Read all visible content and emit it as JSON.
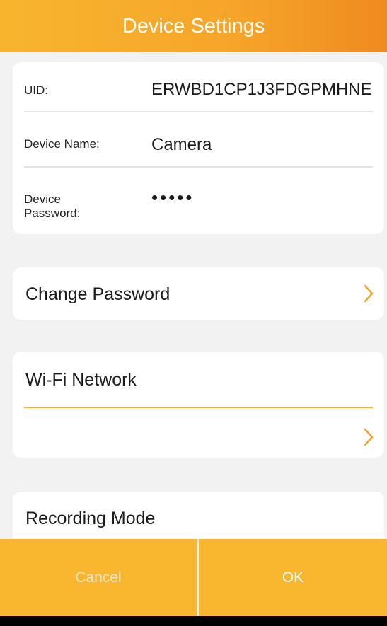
{
  "header": {
    "title": "Device Settings"
  },
  "device_info": {
    "uid": {
      "label": "UID:",
      "value": "ERWBD1CP1J3FDGPMHNE"
    },
    "name": {
      "label": "Device Name:",
      "value": "Camera"
    },
    "password": {
      "label": "Device Password:",
      "value": "•••••"
    }
  },
  "change_password": {
    "label": "Change Password"
  },
  "wifi": {
    "label": "Wi-Fi Network",
    "value": ""
  },
  "recording": {
    "label": "Recording Mode"
  },
  "footer": {
    "cancel_label": "Cancel",
    "ok_label": "OK"
  },
  "colors": {
    "accent": "#f8b52e",
    "header_gradient_end": "#ef8a1f",
    "chevron": "#f4a22d",
    "background": "#f2f2f2"
  },
  "icons": {
    "row_chevron": "chevron-right-icon"
  }
}
